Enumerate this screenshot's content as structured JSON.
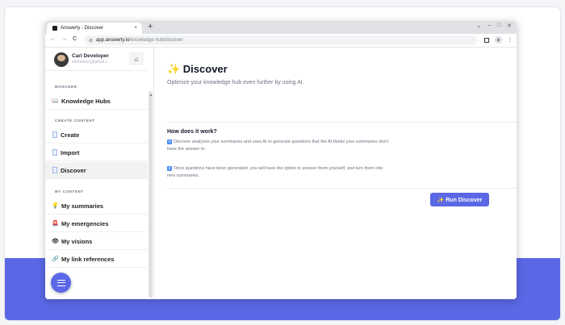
{
  "browser": {
    "tab_title": "Answerly - Discover",
    "tab_close": "×",
    "new_tab": "+",
    "window_controls": [
      "⌄",
      "–",
      "□",
      "✕"
    ],
    "back": "←",
    "forward": "→",
    "reload": "C",
    "url_host": "app.answerly.io",
    "url_path": "/knowledge-hub/discover",
    "menu": "⋮"
  },
  "user": {
    "name": "Carl Developer",
    "email": "sedubleuo@gmail.c..."
  },
  "sidebar": {
    "manager_label": "MANAGER",
    "knowledge_hubs": "Knowledge Hubs",
    "create_content_label": "CREATE CONTENT",
    "create": "Create",
    "import": "Import",
    "discover": "Discover",
    "my_content_label": "MY CONTENT",
    "my_summaries": "My summaries",
    "my_emergencies": "My emergencies",
    "my_visions": "My visions",
    "my_link_references": "My link references"
  },
  "main": {
    "title": "✨ Discover",
    "subtitle": "Optimize your knowledge hub even further by using AI.",
    "how_title": "How does it work?",
    "step1_num": "1",
    "step1_text": "Discover analyzes your summaries and uses AI to generate questions that the AI thinks your summaries don't have the answer to.",
    "step2_num": "2",
    "step2_text": "Once questions have been generated, you will have the option to answer them yourself, and turn them into new summaries.",
    "run_button": "✨ Run Discover"
  },
  "colors": {
    "accent": "#5b68e6",
    "badge": "#4c8df6"
  }
}
